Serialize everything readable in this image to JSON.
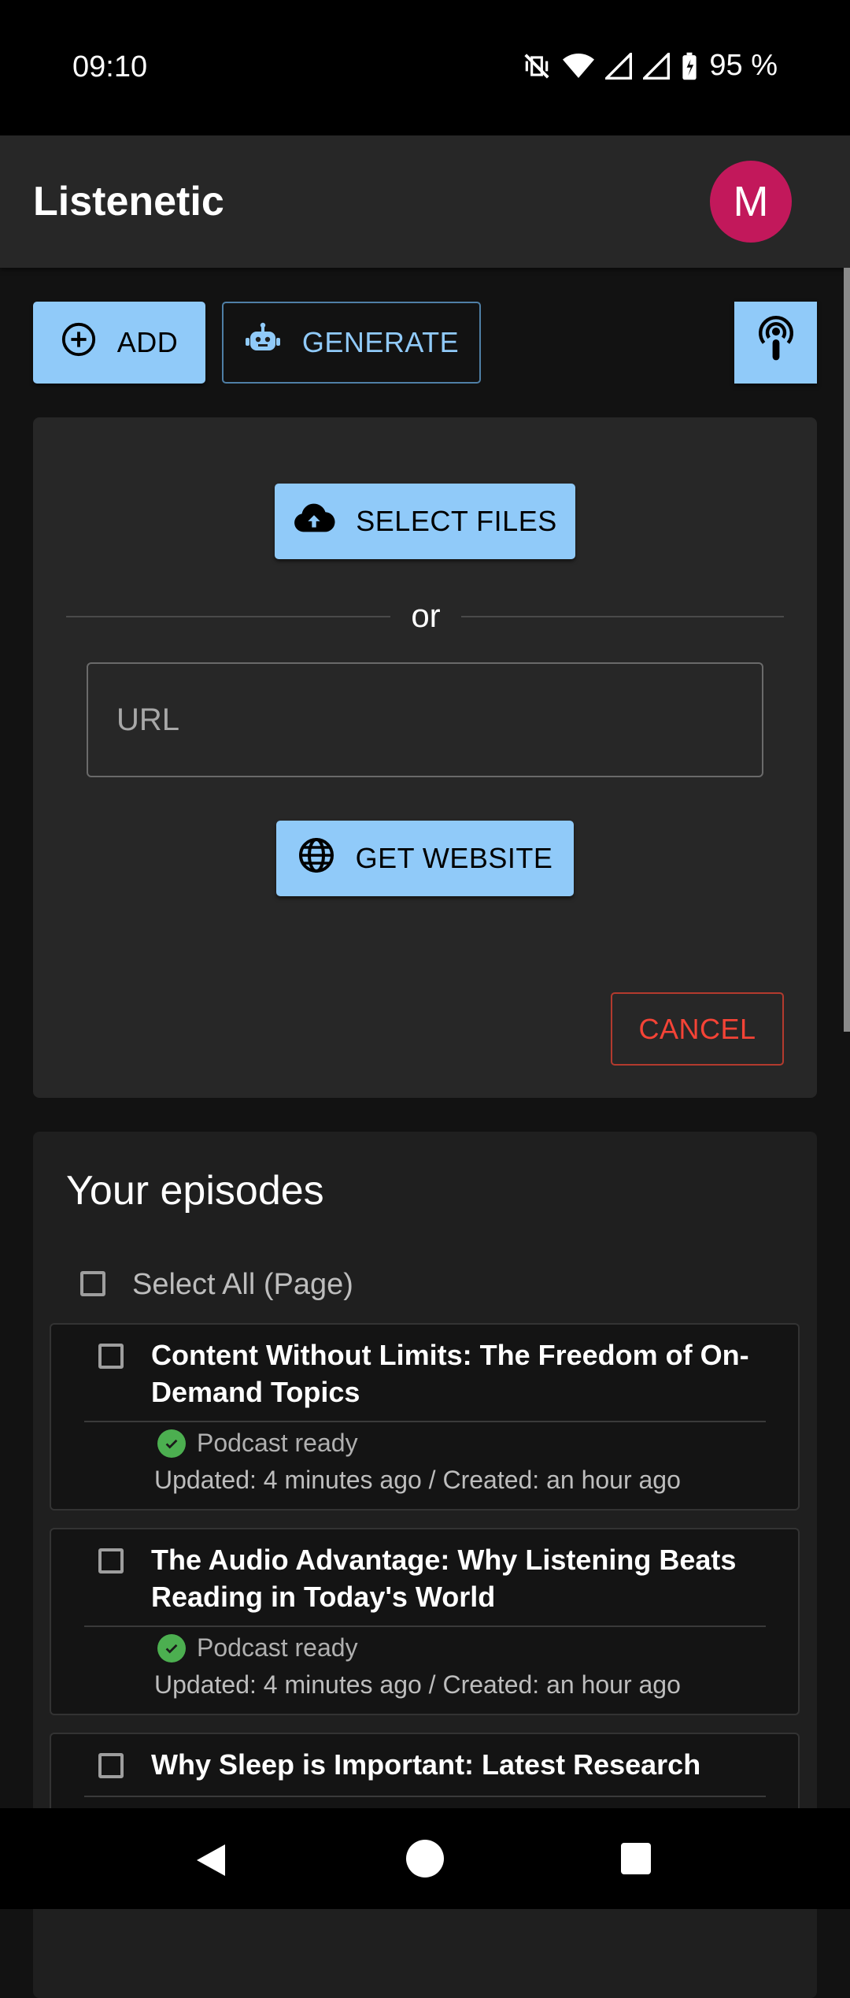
{
  "status_bar": {
    "time": "09:10",
    "battery": "95 %"
  },
  "app_bar": {
    "title": "Listenetic",
    "avatar_initial": "M"
  },
  "toolbar": {
    "add_label": "ADD",
    "generate_label": "GENERATE"
  },
  "upload": {
    "select_files_label": "SELECT FILES",
    "or_text": "or",
    "url_placeholder": "URL",
    "url_value": "",
    "get_website_label": "GET WEBSITE",
    "cancel_label": "CANCEL"
  },
  "episodes": {
    "title": "Your episodes",
    "select_all_label": "Select All (Page)",
    "items": [
      {
        "title": "Content Without Limits: The Freedom of On-Demand Topics",
        "status": "Podcast ready",
        "dates": "Updated: 4 minutes ago / Created: an hour ago"
      },
      {
        "title": "The Audio Advantage: Why Listening Beats Reading in Today's World",
        "status": "Podcast ready",
        "dates": "Updated: 4 minutes ago / Created: an hour ago"
      },
      {
        "title": "Why Sleep is Important: Latest Research",
        "status": "",
        "dates": ""
      }
    ]
  },
  "colors": {
    "accent": "#90caf9",
    "avatar": "#c2185b",
    "danger": "#f44336",
    "success": "#4caf50"
  }
}
